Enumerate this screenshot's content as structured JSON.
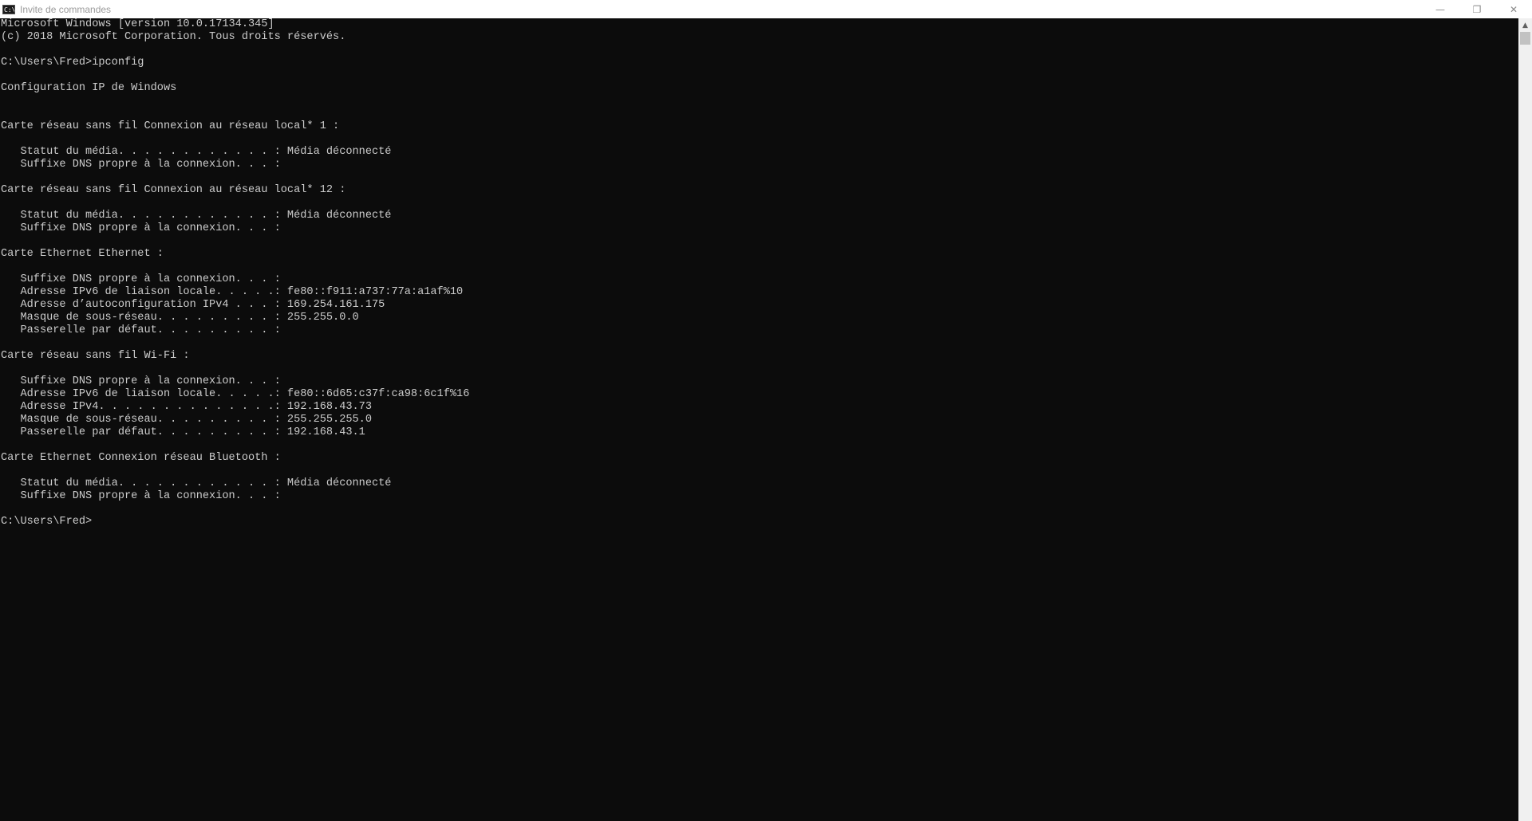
{
  "window": {
    "title": "Invite de commandes",
    "icon_text": "C:\\",
    "minimize_glyph": "—",
    "maximize_glyph": "❐",
    "close_glyph": "✕"
  },
  "scrollbar": {
    "up_glyph": "▲"
  },
  "console": {
    "lines": [
      "Microsoft Windows [version 10.0.17134.345]",
      "(c) 2018 Microsoft Corporation. Tous droits réservés.",
      "",
      "C:\\Users\\Fred>ipconfig",
      "",
      "Configuration IP de Windows",
      "",
      "",
      "Carte réseau sans fil Connexion au réseau local* 1 :",
      "",
      "   Statut du média. . . . . . . . . . . . : Média déconnecté",
      "   Suffixe DNS propre à la connexion. . . :",
      "",
      "Carte réseau sans fil Connexion au réseau local* 12 :",
      "",
      "   Statut du média. . . . . . . . . . . . : Média déconnecté",
      "   Suffixe DNS propre à la connexion. . . :",
      "",
      "Carte Ethernet Ethernet :",
      "",
      "   Suffixe DNS propre à la connexion. . . :",
      "   Adresse IPv6 de liaison locale. . . . .: fe80::f911:a737:77a:a1af%10",
      "   Adresse d’autoconfiguration IPv4 . . . : 169.254.161.175",
      "   Masque de sous-réseau. . . . . . . . . : 255.255.0.0",
      "   Passerelle par défaut. . . . . . . . . :",
      "",
      "Carte réseau sans fil Wi-Fi :",
      "",
      "   Suffixe DNS propre à la connexion. . . :",
      "   Adresse IPv6 de liaison locale. . . . .: fe80::6d65:c37f:ca98:6c1f%16",
      "   Adresse IPv4. . . . . . . . . . . . . .: 192.168.43.73",
      "   Masque de sous-réseau. . . . . . . . . : 255.255.255.0",
      "   Passerelle par défaut. . . . . . . . . : 192.168.43.1",
      "",
      "Carte Ethernet Connexion réseau Bluetooth :",
      "",
      "   Statut du média. . . . . . . . . . . . : Média déconnecté",
      "   Suffixe DNS propre à la connexion. . . :",
      "",
      "C:\\Users\\Fred>"
    ]
  }
}
